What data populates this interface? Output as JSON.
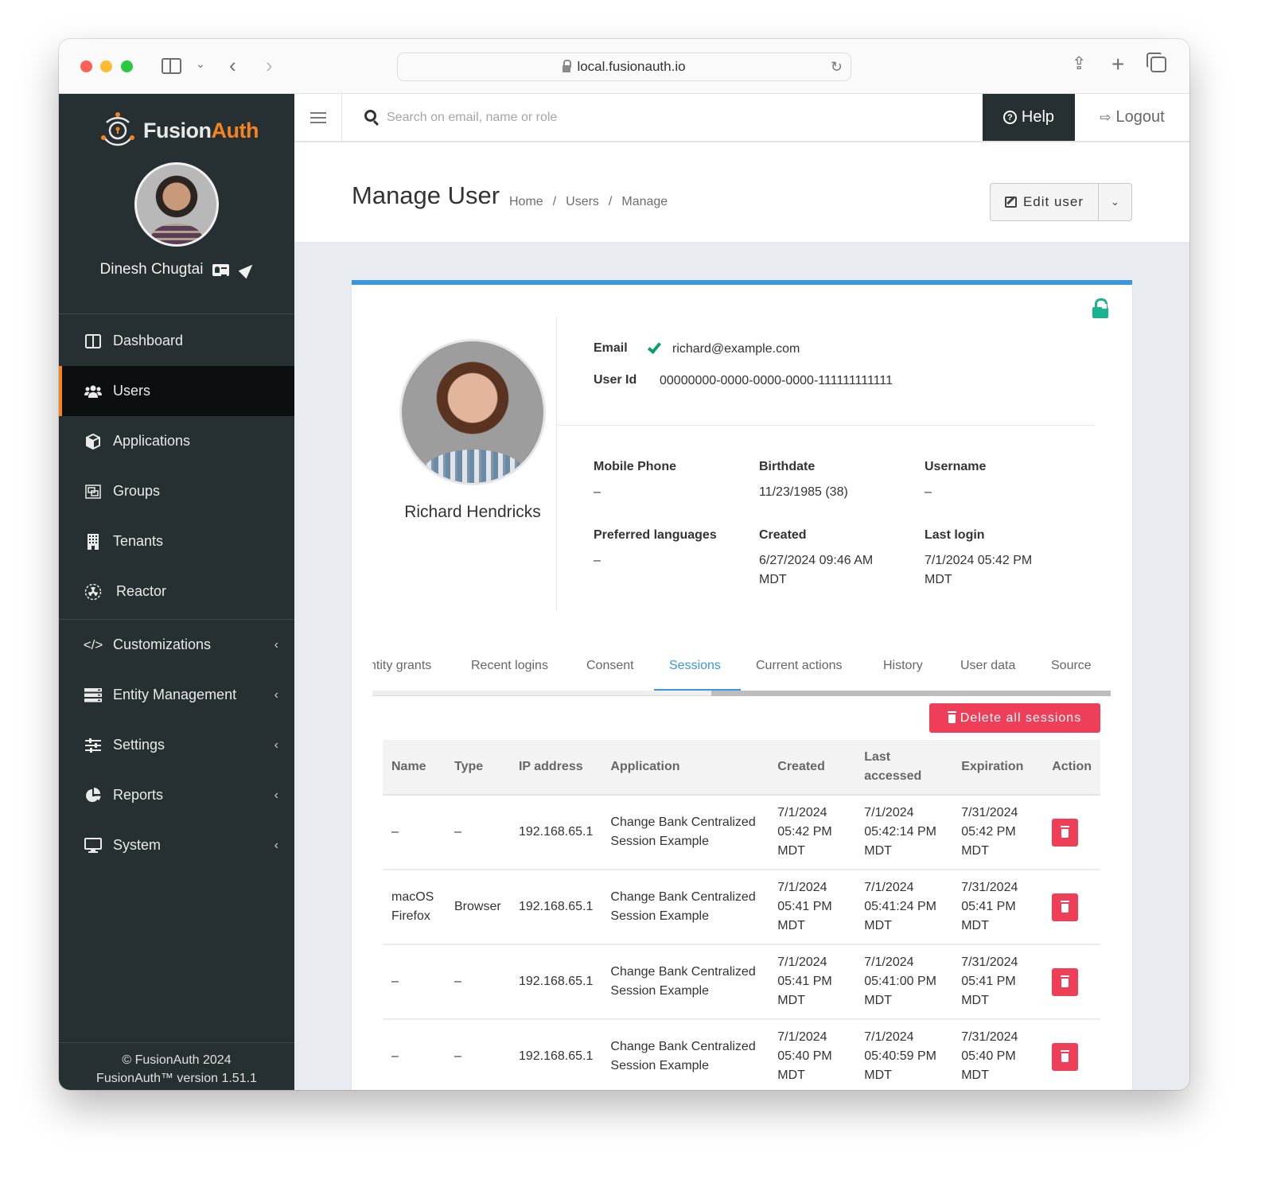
{
  "browser": {
    "url": "local.fusionauth.io"
  },
  "sidebar": {
    "logo": {
      "fusion": "Fusion",
      "auth": "Auth"
    },
    "current_user": "Dinesh Chugtai",
    "items": [
      {
        "label": "Dashboard",
        "icon": "columns-icon",
        "active": false,
        "expandable": false
      },
      {
        "label": "Users",
        "icon": "users-icon",
        "active": true,
        "expandable": false
      },
      {
        "label": "Applications",
        "icon": "cube-icon",
        "active": false,
        "expandable": false
      },
      {
        "label": "Groups",
        "icon": "object-group-icon",
        "active": false,
        "expandable": false
      },
      {
        "label": "Tenants",
        "icon": "building-icon",
        "active": false,
        "expandable": false
      },
      {
        "label": "Reactor",
        "icon": "radiation-icon",
        "active": false,
        "expandable": false
      },
      {
        "label": "Customizations",
        "icon": "code-icon",
        "active": false,
        "expandable": true
      },
      {
        "label": "Entity Management",
        "icon": "server-icon",
        "active": false,
        "expandable": true
      },
      {
        "label": "Settings",
        "icon": "sliders-icon",
        "active": false,
        "expandable": true
      },
      {
        "label": "Reports",
        "icon": "pie-chart-icon",
        "active": false,
        "expandable": true
      },
      {
        "label": "System",
        "icon": "desktop-icon",
        "active": false,
        "expandable": true
      }
    ],
    "footer": {
      "copyright": "© FusionAuth 2024",
      "version": "FusionAuth™ version 1.51.1"
    }
  },
  "topbar": {
    "search_placeholder": "Search on email, name or role",
    "help_label": "Help",
    "logout_label": "Logout"
  },
  "header": {
    "title": "Manage User",
    "breadcrumb": [
      "Home",
      "Users",
      "Manage"
    ],
    "edit_label": "Edit user"
  },
  "user": {
    "name": "Richard Hendricks",
    "email_label": "Email",
    "email": "richard@example.com",
    "email_verified": true,
    "user_id_label": "User Id",
    "user_id": "00000000-0000-0000-0000-111111111111",
    "locked": false,
    "fields": [
      {
        "label": "Mobile Phone",
        "value": "–"
      },
      {
        "label": "Birthdate",
        "value": "11/23/1985 (38)"
      },
      {
        "label": "Username",
        "value": "–"
      },
      {
        "label": "Preferred languages",
        "value": "–"
      },
      {
        "label": "Created",
        "value": "6/27/2024 09:46 AM MDT"
      },
      {
        "label": "Last login",
        "value": "7/1/2024 05:42 PM MDT"
      }
    ]
  },
  "tabs": [
    {
      "label": "ntity grants",
      "active": false
    },
    {
      "label": "Recent logins",
      "active": false
    },
    {
      "label": "Consent",
      "active": false
    },
    {
      "label": "Sessions",
      "active": true
    },
    {
      "label": "Current actions",
      "active": false
    },
    {
      "label": "History",
      "active": false
    },
    {
      "label": "User data",
      "active": false
    },
    {
      "label": "Source",
      "active": false
    }
  ],
  "sessions": {
    "delete_all_label": "Delete all sessions",
    "columns": [
      "Name",
      "Type",
      "IP address",
      "Application",
      "Created",
      "Last accessed",
      "Expiration",
      "Action"
    ],
    "rows": [
      {
        "name": "–",
        "type": "–",
        "ip": "192.168.65.1",
        "application": "Change Bank Centralized Session Example",
        "created": "7/1/2024 05:42 PM MDT",
        "last_accessed": "7/1/2024 05:42:14 PM MDT",
        "expiration": "7/31/2024 05:42 PM MDT"
      },
      {
        "name": "macOS Firefox",
        "type": "Browser",
        "ip": "192.168.65.1",
        "application": "Change Bank Centralized Session Example",
        "created": "7/1/2024 05:41 PM MDT",
        "last_accessed": "7/1/2024 05:41:24 PM MDT",
        "expiration": "7/31/2024 05:41 PM MDT"
      },
      {
        "name": "–",
        "type": "–",
        "ip": "192.168.65.1",
        "application": "Change Bank Centralized Session Example",
        "created": "7/1/2024 05:41 PM MDT",
        "last_accessed": "7/1/2024 05:41:00 PM MDT",
        "expiration": "7/31/2024 05:41 PM MDT"
      },
      {
        "name": "–",
        "type": "–",
        "ip": "192.168.65.1",
        "application": "Change Bank Centralized Session Example",
        "created": "7/1/2024 05:40 PM MDT",
        "last_accessed": "7/1/2024 05:40:59 PM MDT",
        "expiration": "7/31/2024 05:40 PM MDT"
      }
    ]
  },
  "colors": {
    "sidebar_bg": "#263032",
    "brand_orange": "#f58320",
    "accent_blue": "#3a97dc",
    "danger_red": "#ee3e58",
    "success_green": "#18b48f"
  }
}
